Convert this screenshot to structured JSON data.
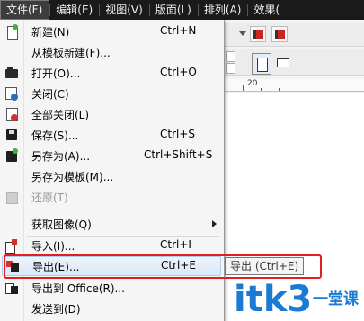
{
  "menubar": {
    "items": [
      {
        "label": "文件(F)"
      },
      {
        "label": "编辑(E)"
      },
      {
        "label": "视图(V)"
      },
      {
        "label": "版面(L)"
      },
      {
        "label": "排列(A)"
      },
      {
        "label": "效果("
      }
    ]
  },
  "file_menu": {
    "items": [
      {
        "label": "新建(N)",
        "shortcut": "Ctrl+N"
      },
      {
        "label": "从模板新建(F)...",
        "shortcut": ""
      },
      {
        "label": "打开(O)...",
        "shortcut": "Ctrl+O"
      },
      {
        "label": "关闭(C)",
        "shortcut": ""
      },
      {
        "label": "全部关闭(L)",
        "shortcut": ""
      },
      {
        "label": "保存(S)...",
        "shortcut": "Ctrl+S"
      },
      {
        "label": "另存为(A)...",
        "shortcut": "Ctrl+Shift+S"
      },
      {
        "label": "另存为模板(M)...",
        "shortcut": ""
      },
      {
        "label": "还原(T)",
        "shortcut": "",
        "disabled": true
      },
      {
        "label": "获取图像(Q)",
        "shortcut": "",
        "submenu": true
      },
      {
        "label": "导入(I)...",
        "shortcut": "Ctrl+I"
      },
      {
        "label": "导出(E)...",
        "shortcut": "Ctrl+E",
        "highlighted": true
      },
      {
        "label": "导出到 Office(R)...",
        "shortcut": ""
      },
      {
        "label": "发送到(D)",
        "shortcut": ""
      }
    ]
  },
  "tooltip": {
    "text": "导出 (Ctrl+E)"
  },
  "ruler": {
    "label": "20"
  },
  "watermark": {
    "text": "itk3",
    "text2": "一堂课"
  },
  "colors": {
    "highlight": "#e02020",
    "watermark": "#1b7bd4",
    "menubar_bg": "#1a1a1a"
  }
}
